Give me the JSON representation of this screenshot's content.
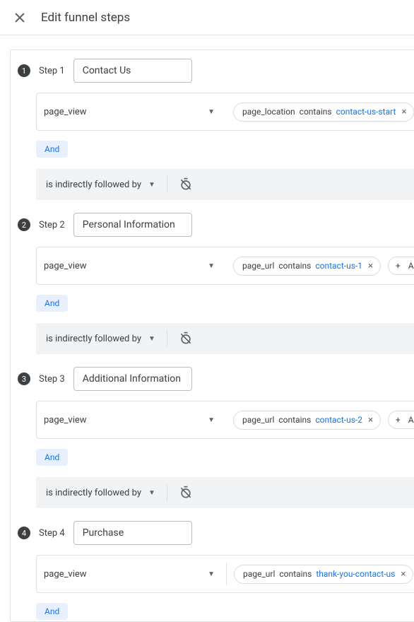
{
  "header": {
    "title": "Edit funnel steps"
  },
  "shared": {
    "and_label": "And",
    "follow_label": "is indirectly followed by",
    "add_label": "Ad",
    "plus": "+"
  },
  "steps": [
    {
      "num": "1",
      "label": "Step 1",
      "name": "Contact Us",
      "event": "page_view",
      "conditions": [
        {
          "param": "page_location",
          "op": "contains",
          "value": "contact-us-start",
          "remove": "×"
        }
      ],
      "show_add": false,
      "show_follow": true
    },
    {
      "num": "2",
      "label": "Step 2",
      "name": "Personal Information",
      "event": "page_view",
      "conditions": [
        {
          "param": "page_url",
          "op": "contains",
          "value": "contact-us-1",
          "remove": "×"
        }
      ],
      "show_add": true,
      "show_follow": true
    },
    {
      "num": "3",
      "label": "Step 3",
      "name": "Additional Information",
      "event": "page_view",
      "conditions": [
        {
          "param": "page_url",
          "op": "contains",
          "value": "contact-us-2",
          "remove": "×"
        }
      ],
      "show_add": true,
      "show_follow": true
    },
    {
      "num": "4",
      "label": "Step 4",
      "name": "Purchase",
      "event": "page_view",
      "conditions": [
        {
          "param": "page_url",
          "op": "contains",
          "value": "thank-you-contact-us",
          "remove": "×"
        }
      ],
      "show_add": false,
      "show_follow": false
    }
  ]
}
